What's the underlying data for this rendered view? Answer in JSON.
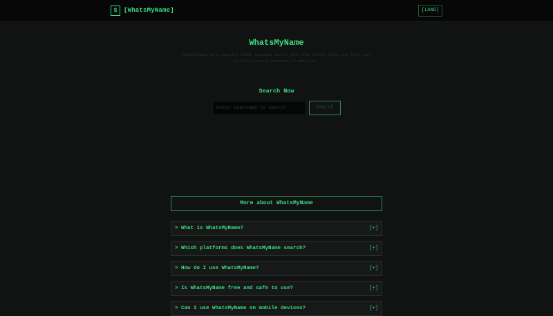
{
  "header": {
    "logo_icon": "$",
    "logo_text": "[WhatsMyName]",
    "lang_button": "[LANG]"
  },
  "hero": {
    "title": "WhatsMyName",
    "description": "WhatsMyName is a powerful OSINT username search tool that safely helps you find your profiles across hundreds of websites."
  },
  "search": {
    "label": "Search Now",
    "placeholder": "Enter username to search",
    "button": "Search"
  },
  "more": {
    "title": "More about WhatsMyName"
  },
  "faq": {
    "items": [
      {
        "question": "> What is WhatsMyName?",
        "toggle": "[+]"
      },
      {
        "question": "> Which platforms does WhatsMyName search?",
        "toggle": "[+]"
      },
      {
        "question": "> How do I use WhatsMyName?",
        "toggle": "[+]"
      },
      {
        "question": "> Is WhatsMyName free and safe to use?",
        "toggle": "[+]"
      },
      {
        "question": "> Can I use WhatsMyName on mobile devices?",
        "toggle": "[+]"
      }
    ]
  },
  "colors": {
    "accent": "#3ddc84",
    "background": "#111312",
    "header_background": "#070707"
  }
}
